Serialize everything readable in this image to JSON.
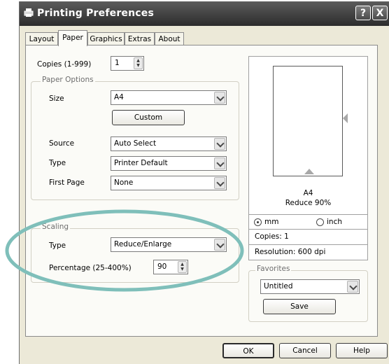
{
  "window": {
    "title": "Printing Preferences",
    "help_btn": "?",
    "close_btn": "X"
  },
  "tabs": [
    {
      "label": "Layout",
      "active": false
    },
    {
      "label": "Paper",
      "active": true
    },
    {
      "label": "Graphics",
      "active": false
    },
    {
      "label": "Extras",
      "active": false
    },
    {
      "label": "About",
      "active": false
    }
  ],
  "copies": {
    "label": "Copies (1-999)",
    "value": "1"
  },
  "paper_options": {
    "title": "Paper Options",
    "size_label": "Size",
    "size_value": "A4",
    "custom_button": "Custom",
    "source_label": "Source",
    "source_value": "Auto Select",
    "type_label": "Type",
    "type_value": "Printer Default",
    "first_page_label": "First Page",
    "first_page_value": "None"
  },
  "scaling": {
    "title": "Scaling",
    "type_label": "Type",
    "type_value": "Reduce/Enlarge",
    "percentage_label": "Percentage (25-400%)",
    "percentage_value": "90"
  },
  "preview": {
    "paper_size": "A4",
    "reduce_text": "Reduce 90%",
    "unit_mm": "mm",
    "unit_inch": "inch",
    "selected_unit": "mm",
    "copies_text": "Copies: 1",
    "resolution_text": "Resolution: 600 dpi"
  },
  "favorites": {
    "title": "Favorites",
    "value": "Untitled",
    "save_button": "Save"
  },
  "buttons": {
    "ok": "OK",
    "cancel": "Cancel",
    "help": "Help"
  },
  "annotation": {
    "ellipse_color": "#7fbfba"
  }
}
